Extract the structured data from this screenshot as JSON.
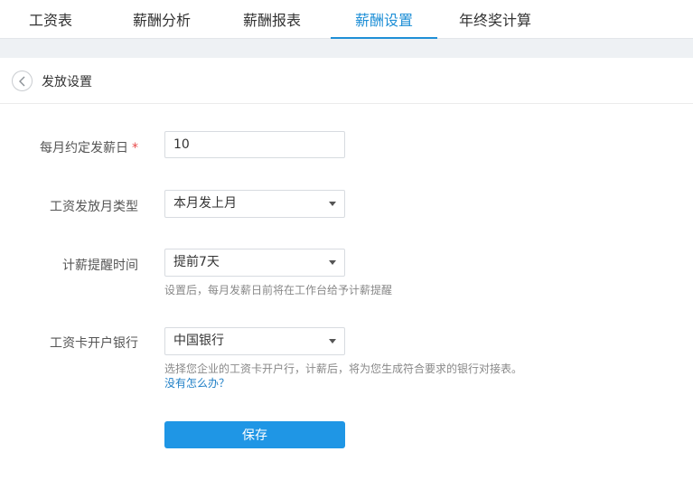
{
  "tabs": [
    {
      "label": "工资表",
      "active": false
    },
    {
      "label": "薪酬分析",
      "active": false
    },
    {
      "label": "薪酬报表",
      "active": false
    },
    {
      "label": "薪酬设置",
      "active": true
    },
    {
      "label": "年终奖计算",
      "active": false
    }
  ],
  "subheader": {
    "back_icon": "chevron-left-icon",
    "title": "发放设置"
  },
  "form": {
    "payday": {
      "label": "每月约定发薪日",
      "required_mark": "*",
      "value": "10"
    },
    "pay_month_type": {
      "label": "工资发放月类型",
      "value": "本月发上月"
    },
    "reminder": {
      "label": "计薪提醒时间",
      "value": "提前7天",
      "hint": "设置后，每月发薪日前将在工作台给予计薪提醒"
    },
    "bank": {
      "label": "工资卡开户银行",
      "value": "中国银行",
      "hint": "选择您企业的工资卡开户行，计薪后，将为您生成符合要求的银行对接表。",
      "help_link": "没有怎么办？"
    }
  },
  "save_label": "保存",
  "colors": {
    "accent": "#1f8fd6",
    "button": "#1f96e5",
    "required": "#e84a4a",
    "link": "#1f7fc6"
  }
}
